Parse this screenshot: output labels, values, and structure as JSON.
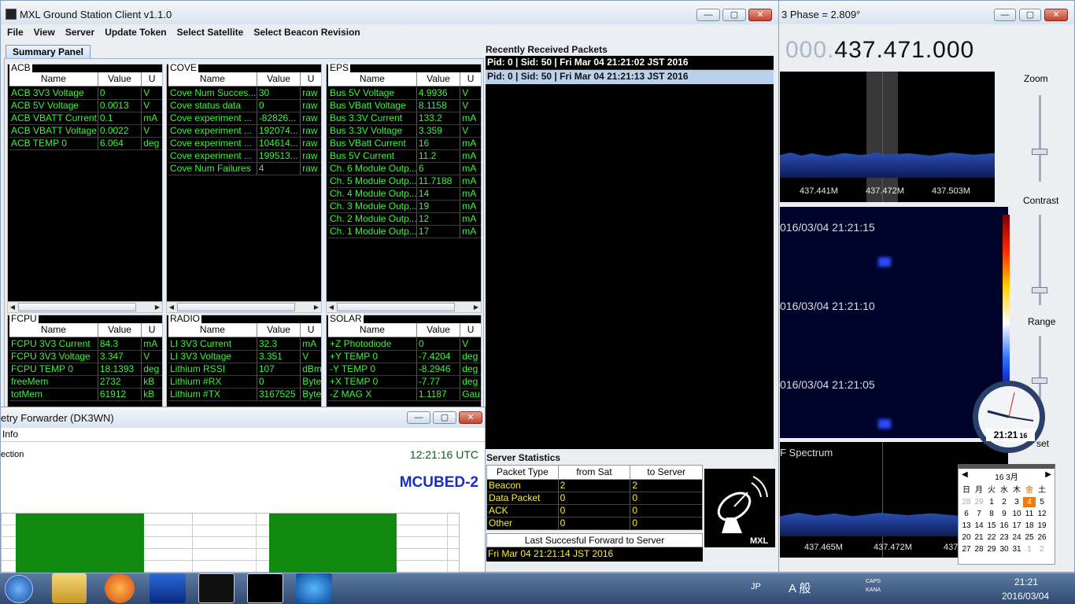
{
  "right_window": {
    "title": "3 Phase = 2.809°",
    "frequency_dim": "000.",
    "frequency_main": "437.471.000",
    "spec_ticks": [
      "437.441M",
      "437.472M",
      "437.503M"
    ],
    "zoom_label": "Zoom",
    "contrast_label": "Contrast",
    "range_label": "Range",
    "offset_label": "set",
    "timestamps": [
      "016/03/04 21:21:15",
      "016/03/04 21:21:10",
      "016/03/04 21:21:05"
    ],
    "spectrum_label": "F Spectrum",
    "spectrum_ticks": [
      "437.465M",
      "437.472M",
      "437"
    ]
  },
  "main": {
    "title": "MXL Ground Station Client v1.1.0",
    "menu": [
      "File",
      "View",
      "Server",
      "Update Token",
      "Select Satellite",
      "Select Beacon Revision"
    ],
    "tab": "Summary Panel",
    "col_name": "Name",
    "col_value": "Value",
    "col_unit": "U",
    "panels": [
      {
        "name": "ACB",
        "rows": [
          [
            "ACB 3V3 Voltage",
            "0",
            "V"
          ],
          [
            "ACB 5V Voltage",
            "0.0013",
            "V"
          ],
          [
            "ACB VBATT Current",
            "0.1",
            "mA"
          ],
          [
            "ACB VBATT Voltage",
            "0.0022",
            "V"
          ],
          [
            "ACB TEMP 0",
            "6.064",
            "deg"
          ]
        ]
      },
      {
        "name": "COVE",
        "rows": [
          [
            "Cove Num Succes...",
            "30",
            "raw"
          ],
          [
            "Cove status data",
            "0",
            "raw"
          ],
          [
            "Cove experiment ...",
            "-82826...",
            "raw"
          ],
          [
            "Cove experiment ...",
            "192074...",
            "raw"
          ],
          [
            "Cove experiment ...",
            "104614...",
            "raw"
          ],
          [
            "Cove experiment ...",
            "199513...",
            "raw"
          ],
          [
            "Cove Num Failures",
            "4",
            "raw"
          ]
        ]
      },
      {
        "name": "EPS",
        "rows": [
          [
            "Bus 5V Voltage",
            "4.9936",
            "V"
          ],
          [
            "Bus VBatt Voltage",
            "8.1158",
            "V"
          ],
          [
            "Bus 3.3V Current",
            "133.2",
            "mA"
          ],
          [
            "Bus 3.3V Voltage",
            "3.359",
            "V"
          ],
          [
            "Bus VBatt Current",
            "16",
            "mA"
          ],
          [
            "Bus 5V Current",
            "11.2",
            "mA"
          ],
          [
            "Ch. 6 Module Outp...",
            "6",
            "mA"
          ],
          [
            "Ch. 5 Module Outp...",
            "11.7188",
            "mA"
          ],
          [
            "Ch. 4 Module Outp...",
            "14",
            "mA"
          ],
          [
            "Ch. 3 Module Outp...",
            "19",
            "mA"
          ],
          [
            "Ch. 2 Module Outp...",
            "12",
            "mA"
          ],
          [
            "Ch. 1 Module Outp...",
            "17",
            "mA"
          ]
        ]
      },
      {
        "name": "FCPU",
        "rows": [
          [
            "FCPU 3V3 Current",
            "84.3",
            "mA"
          ],
          [
            "FCPU 3V3 Voltage",
            "3.347",
            "V"
          ],
          [
            "FCPU TEMP 0",
            "18.1393",
            "deg"
          ],
          [
            "freeMem",
            "2732",
            "kB"
          ],
          [
            "totMem",
            "61912",
            "kB"
          ]
        ]
      },
      {
        "name": "RADIO",
        "rows": [
          [
            "LI 3V3 Current",
            "32.3",
            "mA"
          ],
          [
            "LI 3V3 Voltage",
            "3.351",
            "V"
          ],
          [
            "Lithium RSSI",
            "107",
            "dBm"
          ],
          [
            "Lithium #RX",
            "0",
            "Byte"
          ],
          [
            "Lithium #TX",
            "3167525",
            "Byte"
          ]
        ]
      },
      {
        "name": "SOLAR",
        "rows": [
          [
            "+Z Photodiode",
            "0",
            "V"
          ],
          [
            "+Y TEMP 0",
            "-7.4204",
            "deg"
          ],
          [
            "-Y TEMP 0",
            "-8.2946",
            "deg"
          ],
          [
            "+X TEMP 0",
            "-7.77",
            "deg"
          ],
          [
            "-Z MAG X",
            "1.1187",
            "Gau"
          ]
        ]
      }
    ],
    "packets_label": "Recently Received Packets",
    "packets": [
      "Pid: 0 | Sid: 50 | Fri Mar 04 21:21:02 JST 2016",
      "Pid: 0 | Sid: 50 | Fri Mar 04 21:21:13 JST 2016"
    ],
    "stats_label": "Server Statistics",
    "stats_headers": [
      "Packet Type",
      "from Sat",
      "to Server"
    ],
    "stats_rows": [
      [
        "Beacon",
        "2",
        "2"
      ],
      [
        "Data Packet",
        "0",
        "0"
      ],
      [
        "ACK",
        "0",
        "0"
      ],
      [
        "Other",
        "0",
        "0"
      ]
    ],
    "last_forward_label": "Last Succesful Forward to Server",
    "last_forward_value": "Fri Mar 04 21:21:14 JST 2016",
    "logo_text": "MXL"
  },
  "forwarder": {
    "title": "etry Forwarder (DK3WN)",
    "menu": "Info",
    "conn_label": "ection",
    "time": "12:21:16 UTC",
    "satellite": "MCUBED-2"
  },
  "clock": {
    "digital": "21:21",
    "seconds": "16"
  },
  "calendar": {
    "header": "16 3月",
    "weekdays": [
      "日",
      "月",
      "火",
      "水",
      "木",
      "金",
      "土"
    ],
    "days": [
      "28",
      "29",
      "1",
      "2",
      "3",
      "4",
      "5",
      "6",
      "7",
      "8",
      "9",
      "10",
      "11",
      "12",
      "13",
      "14",
      "15",
      "16",
      "17",
      "18",
      "19",
      "20",
      "21",
      "22",
      "23",
      "24",
      "25",
      "26",
      "27",
      "28",
      "29",
      "30",
      "31",
      "1",
      "2"
    ]
  },
  "taskbar": {
    "lang": "JP",
    "ime": "A 般",
    "caps": "CAPS",
    "kana": "KANA",
    "time": "21:21",
    "date": "2016/03/04"
  },
  "colors": {
    "accent_green": "#3ef23e",
    "accent_yellow": "#ffeb3b",
    "satellite_blue": "#1a2fc0",
    "bar_green": "#0f8a0f"
  }
}
